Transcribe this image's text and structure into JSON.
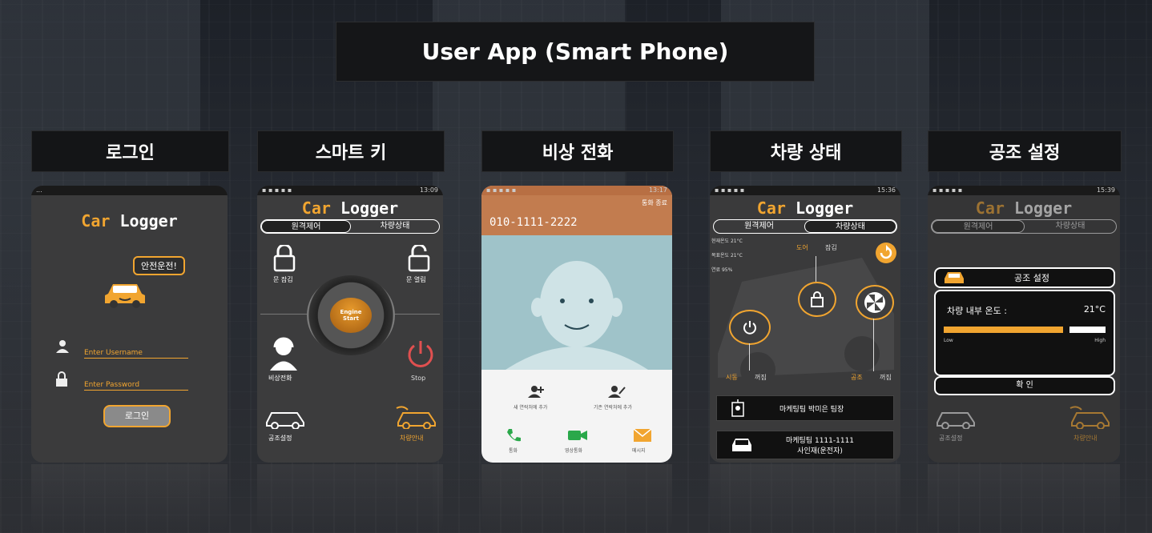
{
  "title": "User App (Smart Phone)",
  "columns": [
    {
      "label": "로그인"
    },
    {
      "label": "스마트 키"
    },
    {
      "label": "비상 전화"
    },
    {
      "label": "차량 상태"
    },
    {
      "label": "공조 설정"
    }
  ],
  "app": {
    "logo_car": "Car",
    "logo_logger": "Logger"
  },
  "login": {
    "status_left": "...",
    "bubble": "안전운전!",
    "username_placeholder": "Enter Username",
    "password_placeholder": "Enter Password",
    "login_button": "로그인"
  },
  "smartkey": {
    "status_time": "13:09",
    "tab_remote": "원격제어",
    "tab_status": "차량상태",
    "lock_label": "문 잠김",
    "unlock_label": "문 열림",
    "engine_line1": "Engine",
    "engine_line2": "Start",
    "emergency_label": "비상전화",
    "stop_label": "Stop",
    "aircon_label": "공조설정",
    "carinfo_label": "차량안내"
  },
  "call": {
    "status_time": "13:17",
    "top_right": "통화 종료",
    "number": "010-1111-2222",
    "action1": "새 연락처에 추가",
    "action2": "기존 연락처에 추가",
    "btn_call": "통화",
    "btn_video": "영상통화",
    "btn_msg": "메시지"
  },
  "status": {
    "status_time": "15:36",
    "tab_remote": "원격제어",
    "tab_status": "차량상태",
    "info1": "현재온도 21°C",
    "info2": "목표온도 21°C",
    "info3": "연료 95%",
    "door": "도어",
    "door_state": "잠김",
    "engine_label": "시동",
    "engine_state": "꺼짐",
    "ac_label": "공조",
    "ac_state": "꺼짐",
    "row1": "마케팅팀 박미은 팀장",
    "row2_l1": "마케팅팀 1111-1111",
    "row2_l2": "사인재(운전자)"
  },
  "aircon": {
    "status_time": "15:39",
    "tab_remote": "원격제어",
    "tab_status": "차량상태",
    "header": "공조 설정",
    "temp_label": "차량 내부 온도 :",
    "temp_value": "21°C",
    "low": "Low",
    "high": "High",
    "level": 0.74,
    "confirm": "확 인",
    "aircon_label": "공조설정",
    "carinfo_label": "차량안내"
  },
  "colors": {
    "accent": "#f1a530",
    "call_header": "#c27c4f",
    "call_bg": "#9fc3c9"
  }
}
